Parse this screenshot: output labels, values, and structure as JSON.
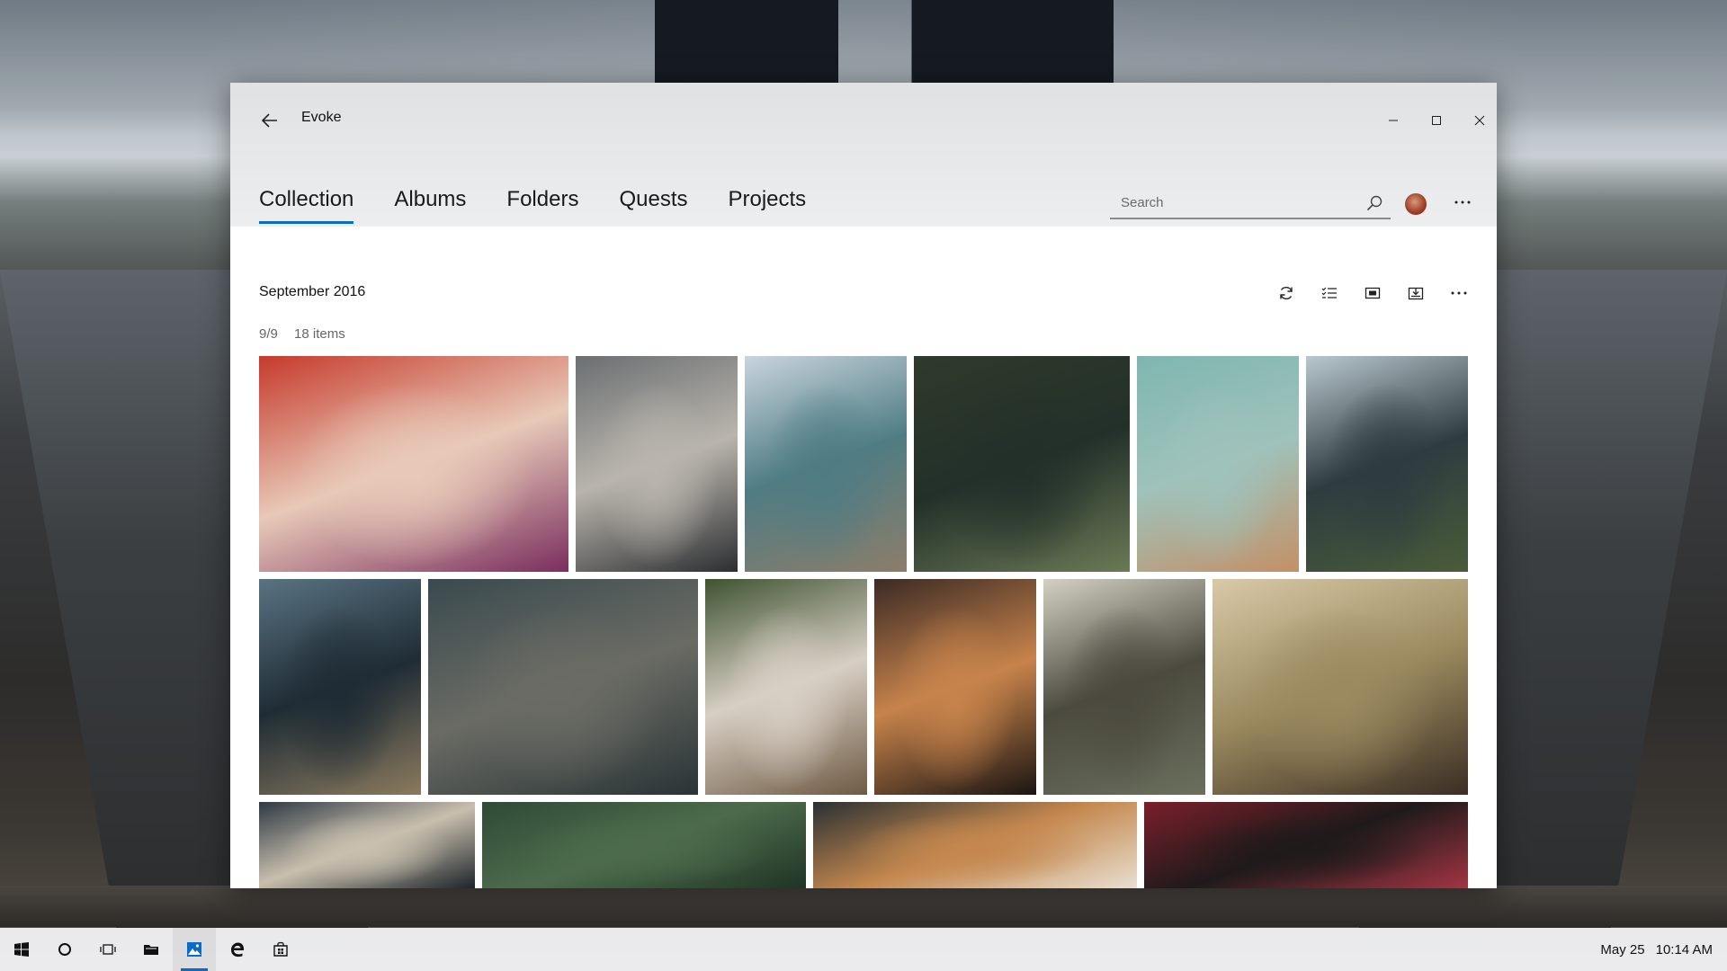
{
  "window": {
    "title": "Evoke"
  },
  "nav": {
    "tabs": [
      {
        "label": "Collection",
        "active": true
      },
      {
        "label": "Albums",
        "active": false
      },
      {
        "label": "Folders",
        "active": false
      },
      {
        "label": "Quests",
        "active": false
      },
      {
        "label": "Projects",
        "active": false
      }
    ],
    "search_placeholder": "Search"
  },
  "content": {
    "section_title": "September 2016",
    "page": "9/9",
    "count": "18 items",
    "toolbar_icons": [
      "refresh-icon",
      "select-list-icon",
      "slideshow-icon",
      "import-icon",
      "more-icon"
    ]
  },
  "photos": [
    {
      "name": "photo-girl-red-leaf",
      "colors": [
        "#c63a2c",
        "#e8c9b8",
        "#7a2e5e"
      ]
    },
    {
      "name": "photo-camera-city",
      "colors": [
        "#6b6f72",
        "#b9b5ad",
        "#2c2e31"
      ]
    },
    {
      "name": "photo-ocean-waves",
      "colors": [
        "#c9d4de",
        "#4f7c83",
        "#8c7d6a"
      ]
    },
    {
      "name": "photo-soccer-player",
      "colors": [
        "#2e3a2a",
        "#23302a",
        "#6a7a55"
      ]
    },
    {
      "name": "photo-dry-grass",
      "colors": [
        "#7fb6b0",
        "#9fc2bb",
        "#c49066"
      ]
    },
    {
      "name": "photo-kayak-lake",
      "colors": [
        "#b9c8cf",
        "#2e3c40",
        "#4a5c39"
      ]
    },
    {
      "name": "photo-beach-sunset",
      "colors": [
        "#5a7382",
        "#1f2c35",
        "#8b7a5e"
      ]
    },
    {
      "name": "photo-sparkler",
      "colors": [
        "#3a4a4e",
        "#6a6b64",
        "#2a3436"
      ]
    },
    {
      "name": "photo-pug-blanket",
      "colors": [
        "#3f5332",
        "#d8cfc4",
        "#6e5a44"
      ]
    },
    {
      "name": "photo-woman-lights",
      "colors": [
        "#3b2a25",
        "#c7834b",
        "#1b1513"
      ]
    },
    {
      "name": "photo-fence-building",
      "colors": [
        "#d4d1c4",
        "#4b4a3e",
        "#6b705d"
      ]
    },
    {
      "name": "photo-man-scarf",
      "colors": [
        "#d8c9a8",
        "#9b8a5f",
        "#3b2e24"
      ]
    },
    {
      "name": "photo-food-table",
      "colors": [
        "#2f3a44",
        "#c9bfae",
        "#1d242a"
      ]
    },
    {
      "name": "photo-forest",
      "colors": [
        "#2f4a36",
        "#4d6b4c",
        "#1f3425"
      ]
    },
    {
      "name": "photo-shiba-dog",
      "colors": [
        "#2a3033",
        "#c4874e",
        "#e8dfd0"
      ]
    },
    {
      "name": "photo-man-sunglasses",
      "colors": [
        "#7a1f2b",
        "#1f1a1a",
        "#a33443"
      ]
    }
  ],
  "taskbar": {
    "items": [
      {
        "name": "start-button",
        "icon": "windows-logo-icon"
      },
      {
        "name": "cortana-button",
        "icon": "cortana-circle-icon"
      },
      {
        "name": "task-view-button",
        "icon": "task-view-icon"
      },
      {
        "name": "file-explorer-button",
        "icon": "folder-icon"
      },
      {
        "name": "photos-app-button",
        "icon": "photos-icon",
        "active": true
      },
      {
        "name": "edge-button",
        "icon": "edge-icon"
      },
      {
        "name": "store-button",
        "icon": "store-icon"
      }
    ],
    "date": "May 25",
    "time": "10:14 AM",
    "accent": "#0a6cc4"
  }
}
